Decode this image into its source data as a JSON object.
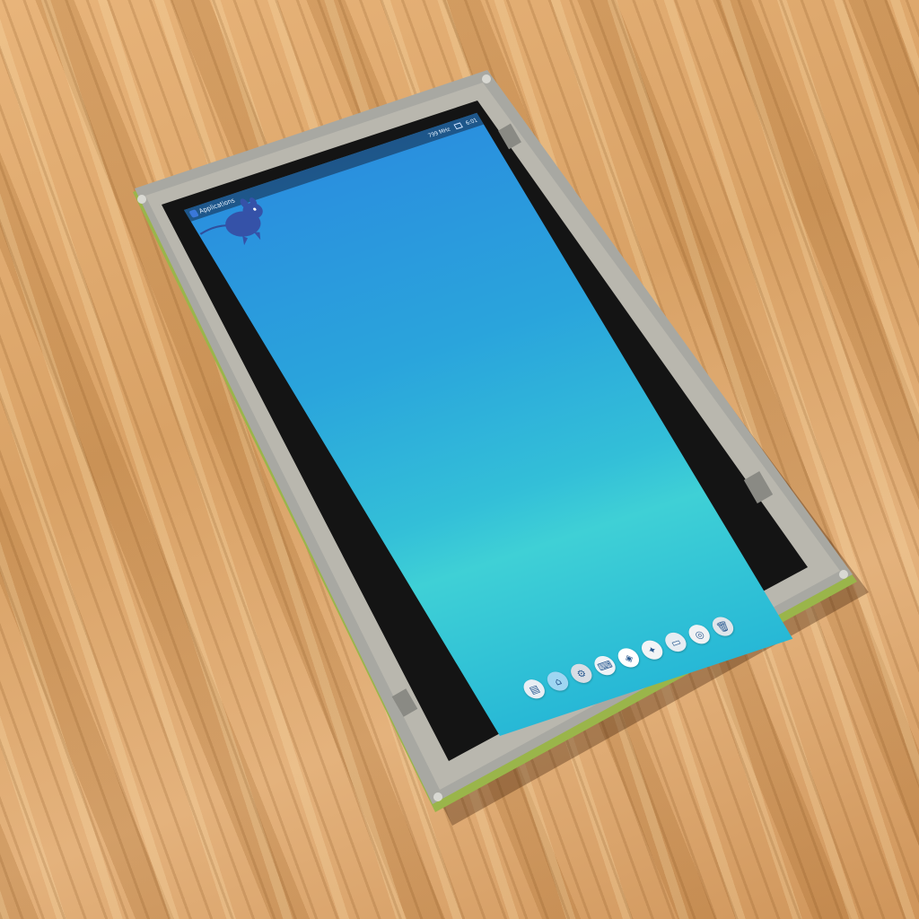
{
  "panel": {
    "menu_label": "Applications",
    "tray_speed": "799 MHz",
    "tray_time": "6:01"
  },
  "desktop": {
    "wallpaper_colors": [
      "#2a8fde",
      "#33bfd8",
      "#3fd0d6"
    ],
    "mascot_icon": "xfce-mouse-icon"
  },
  "dock": {
    "items": [
      {
        "icon": "files-icon",
        "glyph": "▤",
        "color": "#e9eef4"
      },
      {
        "icon": "home-icon",
        "glyph": "⌂",
        "color": "#9fd6f2"
      },
      {
        "icon": "settings-icon",
        "glyph": "⚙",
        "color": "#d8dde4"
      },
      {
        "icon": "keyboard-icon",
        "glyph": "⌨",
        "color": "#eef2f6"
      },
      {
        "icon": "apps-icon",
        "glyph": "◈",
        "color": "#ffffff"
      },
      {
        "icon": "bird-icon",
        "glyph": "✦",
        "color": "#f2f4f6"
      },
      {
        "icon": "folder-icon",
        "glyph": "▭",
        "color": "#e6ecf2"
      },
      {
        "icon": "disk-icon",
        "glyph": "◎",
        "color": "#f0f2f4"
      },
      {
        "icon": "trash-icon",
        "glyph": "🗑",
        "color": "#dfe5ea"
      }
    ]
  }
}
